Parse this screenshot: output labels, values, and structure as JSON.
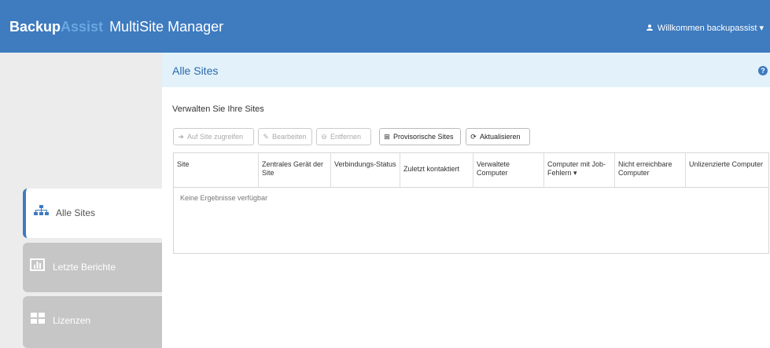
{
  "header": {
    "brand_part1": "Backup",
    "brand_part2": "Assist",
    "brand_part3": "MultiSite Manager",
    "user_label": "Willkommen backupassist",
    "user_caret": "▾"
  },
  "sidebar": {
    "items": [
      {
        "label": "Alle Sites",
        "icon": "sitemap-icon"
      },
      {
        "label": "Letzte Berichte",
        "icon": "bar-chart-icon"
      },
      {
        "label": "Lizenzen",
        "icon": "grid-icon"
      }
    ]
  },
  "main": {
    "title": "Alle Sites",
    "help_glyph": "?",
    "subtitle": "Verwalten Sie Ihre Sites",
    "toolbar": {
      "access": "Auf Site zugreifen",
      "edit": "Bearbeiten",
      "remove": "Entfernen",
      "provisional": "Provisorische Sites",
      "refresh": "Aktualisieren"
    },
    "columns": [
      "Site",
      "Zentrales Gerät der Site",
      "Verbindungs-Status",
      "Zuletzt kontaktiert",
      "Verwaltete Computer",
      "Computer mit Job-Fehlern ▾",
      "Nicht erreichbare Computer",
      "Unlizenzierte Computer"
    ],
    "empty_message": "Keine Ergebnisse verfügbar"
  },
  "colors": {
    "header_bg": "#3e7bbf",
    "title_bar_bg": "#e2f1fa",
    "accent": "#3e7bbf"
  }
}
